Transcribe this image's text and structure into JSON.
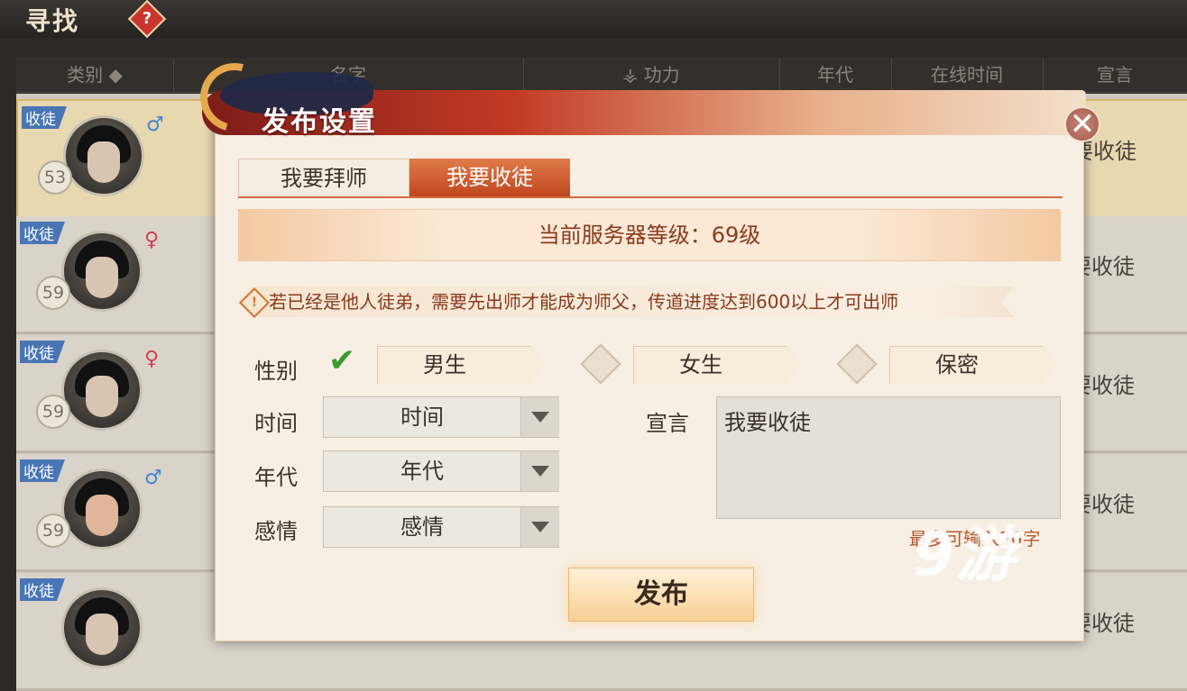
{
  "page": {
    "title": "寻找",
    "help_icon": "?"
  },
  "table": {
    "headers": [
      "类别",
      "名字",
      "功力",
      "年代",
      "在线时间",
      "宣言"
    ],
    "sort_icon": "◆",
    "rows": [
      {
        "tag": "收徒",
        "gender": "♂",
        "level": "53",
        "declaration": "要收徒"
      },
      {
        "tag": "收徒",
        "gender": "♀",
        "level": "59",
        "declaration": "要收徒"
      },
      {
        "tag": "收徒",
        "gender": "♀",
        "level": "59",
        "declaration": "要收徒"
      },
      {
        "tag": "收徒",
        "gender": "♂",
        "level": "59",
        "declaration": "要收徒"
      },
      {
        "tag": "收徒",
        "gender": "",
        "level": "",
        "declaration": "要收徒"
      }
    ]
  },
  "dialog": {
    "title": "发布设置",
    "close_icon": "✕",
    "tabs": [
      "我要拜师",
      "我要收徒"
    ],
    "active_tab": 1,
    "server_level": "当前服务器等级：69级",
    "notice": "若已经是他人徒弟，需要先出师才能成为师父，传道进度达到600以上才可出师",
    "notice_icon": "!",
    "gender_label": "性别",
    "gender_options": [
      "男生",
      "女生",
      "保密"
    ],
    "gender_selected": "男生",
    "check_icon": "✔",
    "time_label": "时间",
    "time_value": "时间",
    "era_label": "年代",
    "era_value": "年代",
    "emotion_label": "感情",
    "emotion_value": "感情",
    "declaration_label": "宣言",
    "declaration_value": "我要收徒",
    "declaration_hint": "最多可输入20字",
    "publish_label": "发布"
  },
  "watermark": "9游",
  "colors": {
    "accent": "#c0461f",
    "tag_blue": "#4876b5",
    "male": "#3f86d6",
    "female": "#cf3f4f",
    "check": "#3d9b2e"
  }
}
